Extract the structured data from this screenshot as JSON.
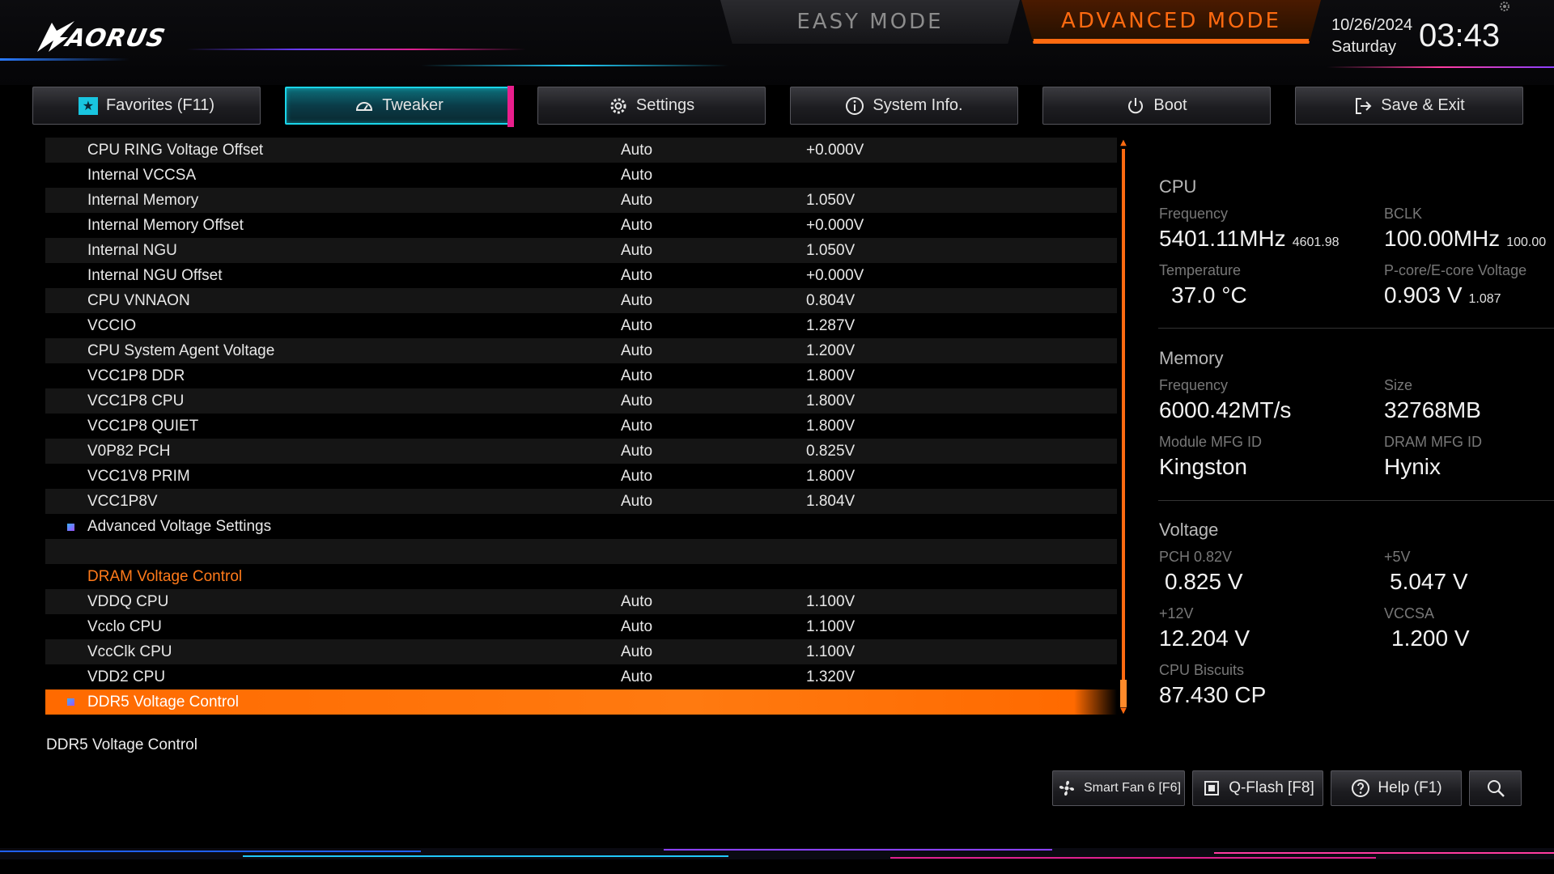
{
  "header": {
    "logo_text": "AORUS",
    "mode_easy": "EASY MODE",
    "mode_advanced": "ADVANCED MODE",
    "date": "10/26/2024",
    "day": "Saturday",
    "time": "03:43"
  },
  "tabs": [
    {
      "label": "Favorites (F11)",
      "icon": "star-icon",
      "active": false
    },
    {
      "label": "Tweaker",
      "icon": "speedometer-icon",
      "active": true
    },
    {
      "label": "Settings",
      "icon": "gear-icon",
      "active": false
    },
    {
      "label": "System Info.",
      "icon": "info-icon",
      "active": false
    },
    {
      "label": "Boot",
      "icon": "power-icon",
      "active": false
    },
    {
      "label": "Save & Exit",
      "icon": "exit-icon",
      "active": false
    }
  ],
  "rows": [
    {
      "label": "CPU RING Voltage Offset",
      "value": "Auto",
      "current": "+0.000V"
    },
    {
      "label": "Internal VCCSA",
      "value": "Auto",
      "current": ""
    },
    {
      "label": "Internal Memory",
      "value": "Auto",
      "current": "1.050V"
    },
    {
      "label": "Internal Memory Offset",
      "value": "Auto",
      "current": "+0.000V"
    },
    {
      "label": "Internal NGU",
      "value": "Auto",
      "current": "1.050V"
    },
    {
      "label": "Internal NGU Offset",
      "value": "Auto",
      "current": "+0.000V"
    },
    {
      "label": "CPU VNNAON",
      "value": "Auto",
      "current": "0.804V"
    },
    {
      "label": "VCCIO",
      "value": "Auto",
      "current": "1.287V"
    },
    {
      "label": "CPU System Agent Voltage",
      "value": "Auto",
      "current": "1.200V"
    },
    {
      "label": "VCC1P8 DDR",
      "value": "Auto",
      "current": "1.800V"
    },
    {
      "label": "VCC1P8 CPU",
      "value": "Auto",
      "current": "1.800V"
    },
    {
      "label": "VCC1P8 QUIET",
      "value": "Auto",
      "current": "1.800V"
    },
    {
      "label": "V0P82 PCH",
      "value": "Auto",
      "current": "0.825V"
    },
    {
      "label": "VCC1V8 PRIM",
      "value": "Auto",
      "current": "1.800V"
    },
    {
      "label": "VCC1P8V",
      "value": "Auto",
      "current": "1.804V"
    },
    {
      "label": "Advanced Voltage Settings",
      "value": "",
      "current": ""
    },
    {
      "label": "",
      "value": "",
      "current": ""
    },
    {
      "label": "DRAM Voltage Control",
      "value": "",
      "current": ""
    },
    {
      "label": "VDDQ CPU",
      "value": "Auto",
      "current": "1.100V"
    },
    {
      "label": "Vcclo CPU",
      "value": "Auto",
      "current": "1.100V"
    },
    {
      "label": "VccClk CPU",
      "value": "Auto",
      "current": "1.100V"
    },
    {
      "label": "VDD2 CPU",
      "value": "Auto",
      "current": "1.320V"
    },
    {
      "label": "DDR5 Voltage Control",
      "value": "",
      "current": ""
    }
  ],
  "help_text": "DDR5 Voltage Control",
  "panel": {
    "cpu": {
      "title": "CPU",
      "freq_label": "Frequency",
      "freq_value": "5401.11MHz",
      "freq_sub": "4601.98",
      "bclk_label": "BCLK",
      "bclk_value": "100.00MHz",
      "bclk_sub": "100.00",
      "temp_label": "Temperature",
      "temp_value": "37.0 °C",
      "volt_label": "P-core/E-core Voltage",
      "volt_value": "0.903 V",
      "volt_sub": "1.087"
    },
    "memory": {
      "title": "Memory",
      "freq_label": "Frequency",
      "freq_value": "6000.42MT/s",
      "size_label": "Size",
      "size_value": "32768MB",
      "module_label": "Module MFG ID",
      "module_value": "Kingston",
      "dram_label": "DRAM MFG ID",
      "dram_value": "Hynix"
    },
    "voltage": {
      "title": "Voltage",
      "pch_label": "PCH 0.82V",
      "pch_value": "0.825 V",
      "v5_label": "+5V",
      "v5_value": "5.047 V",
      "v12_label": "+12V",
      "v12_value": "12.204 V",
      "vccsa_label": "VCCSA",
      "vccsa_value": "1.200 V",
      "biscuits_label": "CPU Biscuits",
      "biscuits_value": "87.430 CP"
    }
  },
  "toolbar": {
    "smartfan": "Smart Fan 6 [F6]",
    "qflash": "Q-Flash [F8]",
    "help": "Help (F1)"
  },
  "colors": {
    "accent": "#ff6a10",
    "tab_active": "#1ad6ea",
    "tab_edge": "#e91e8c"
  }
}
